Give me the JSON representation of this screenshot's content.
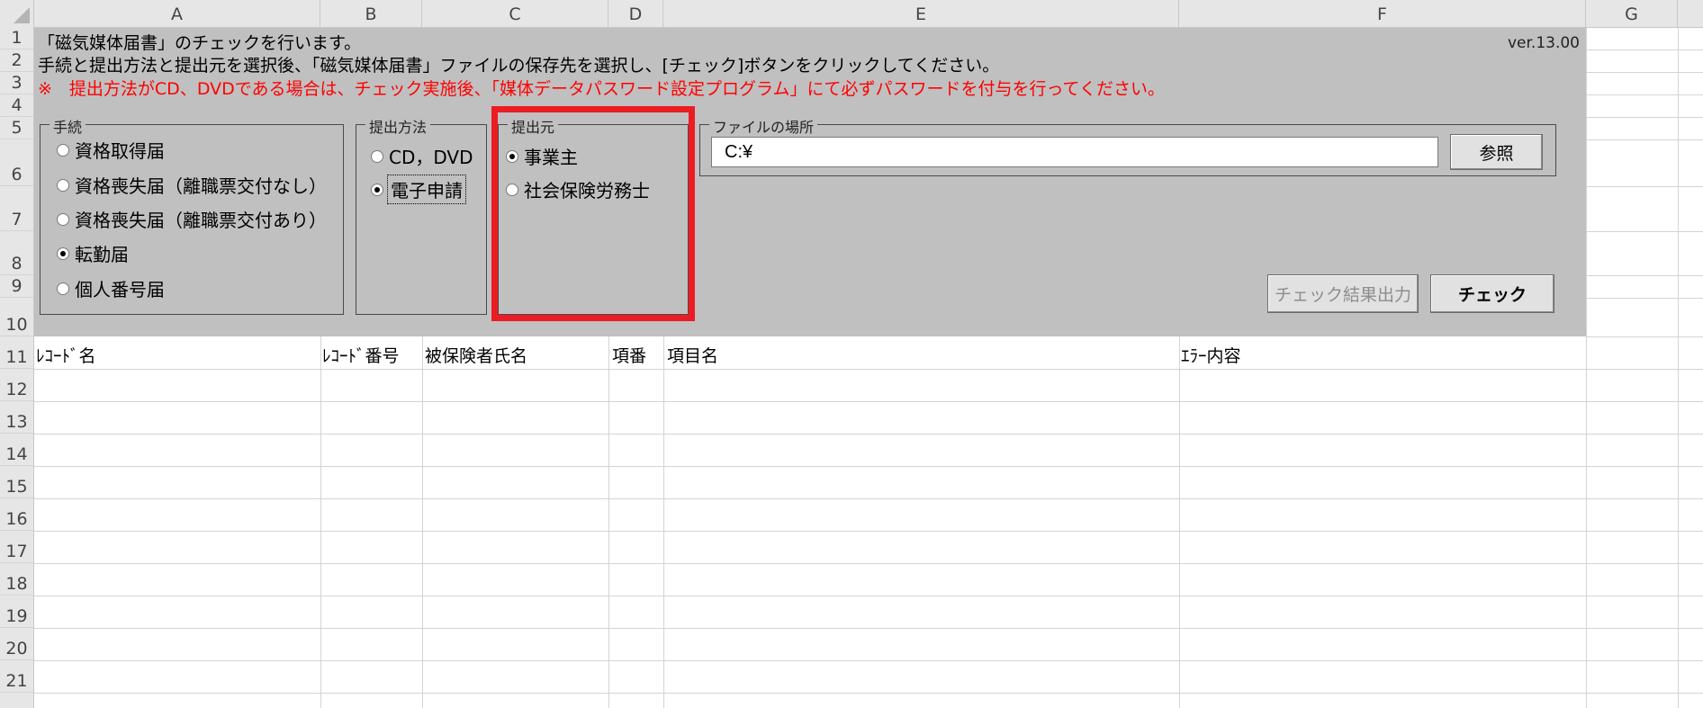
{
  "columns": [
    "A",
    "B",
    "C",
    "D",
    "E",
    "F",
    "G"
  ],
  "rows": [
    "1",
    "2",
    "3",
    "4",
    "5",
    "6",
    "7",
    "8",
    "9",
    "10",
    "11",
    "12",
    "13",
    "14",
    "15",
    "16",
    "17",
    "18",
    "19",
    "20",
    "21"
  ],
  "form": {
    "line1": "「磁気媒体届書」のチェックを行います。",
    "line2": "手続と提出方法と提出元を選択後、「磁気媒体届書」ファイルの保存先を選択し、[チェック]ボタンをクリックしてください。",
    "line3": "※　提出方法がCD、DVDである場合は、チェック実施後、「媒体データパスワード設定プログラム」にて必ずパスワードを付与を行ってください。",
    "version": "ver.13.00",
    "procedure": {
      "title": "手続",
      "options": [
        "資格取得届",
        "資格喪失届（離職票交付なし）",
        "資格喪失届（離職票交付あり）",
        "転勤届",
        "個人番号届"
      ],
      "selected": "転勤届"
    },
    "method": {
      "title": "提出方法",
      "options": [
        "CD，DVD",
        "電子申請"
      ],
      "selected": "電子申請"
    },
    "source": {
      "title": "提出元",
      "options": [
        "事業主",
        "社会保険労務士"
      ],
      "selected": "事業主"
    },
    "file": {
      "title": "ファイルの場所",
      "path": "C:¥",
      "browse_label": "参照"
    },
    "result_button": "チェック結果出力",
    "check_button": "チェック"
  },
  "table_headers": [
    "ﾚｺｰﾄﾞ名",
    "ﾚｺｰﾄﾞ番号",
    "被保険者氏名",
    "項番",
    "項目名",
    "ｴﾗｰ内容"
  ],
  "colors": {
    "panel": "#c0c0c0",
    "highlight": "#ec1c24",
    "warning_text": "#ff0000"
  }
}
